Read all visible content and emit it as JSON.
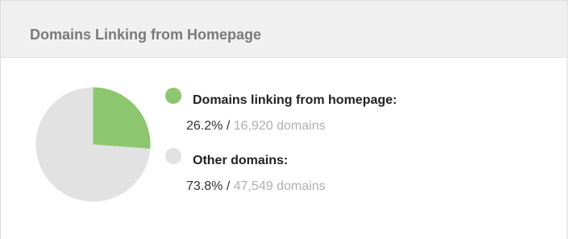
{
  "panel": {
    "title": "Domains Linking from Homepage"
  },
  "legend": {
    "items": [
      {
        "label": "Domains linking from homepage:",
        "percent": "26.2%",
        "separator": "/",
        "count_text": "16,920 domains",
        "color": "#8cc66e"
      },
      {
        "label": "Other domains:",
        "percent": "73.8%",
        "separator": "/",
        "count_text": "47,549 domains",
        "color": "#e2e2e2"
      }
    ]
  },
  "chart_data": {
    "type": "pie",
    "categories": [
      "Domains linking from homepage",
      "Other domains"
    ],
    "values": [
      26.2,
      73.8
    ],
    "counts": [
      16920,
      47549
    ],
    "colors": [
      "#8cc66e",
      "#e2e2e2"
    ]
  }
}
